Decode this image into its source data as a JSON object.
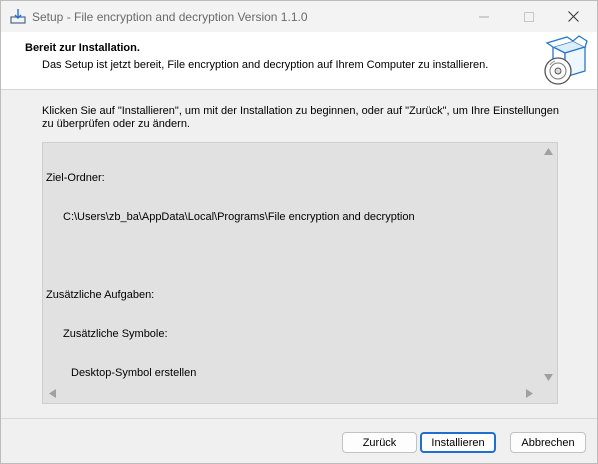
{
  "window": {
    "title": "Setup - File encryption and decryption Version 1.1.0"
  },
  "header": {
    "title": "Bereit zur Installation.",
    "subtitle": "Das Setup ist jetzt bereit, File encryption and decryption auf Ihrem Computer zu installieren."
  },
  "intro": "Klicken Sie auf \"Installieren\", um mit der Installation zu beginnen, oder auf \"Zurück\", um Ihre Einstellungen zu überprüfen oder zu ändern.",
  "memo": {
    "dest_label": "Ziel-Ordner:",
    "dest_path": "C:\\Users\\zb_ba\\AppData\\Local\\Programs\\File encryption and decryption",
    "tasks_label": "Zusätzliche Aufgaben:",
    "symbols_label": "Zusätzliche Symbole:",
    "desktop_item": "Desktop-Symbol erstellen"
  },
  "buttons": {
    "back": "Zurück",
    "install": "Installieren",
    "cancel": "Abbrechen"
  },
  "colors": {
    "accent": "#1f6fd1",
    "header_bg": "#ffffff",
    "memo_bg": "#e1e1e1"
  }
}
